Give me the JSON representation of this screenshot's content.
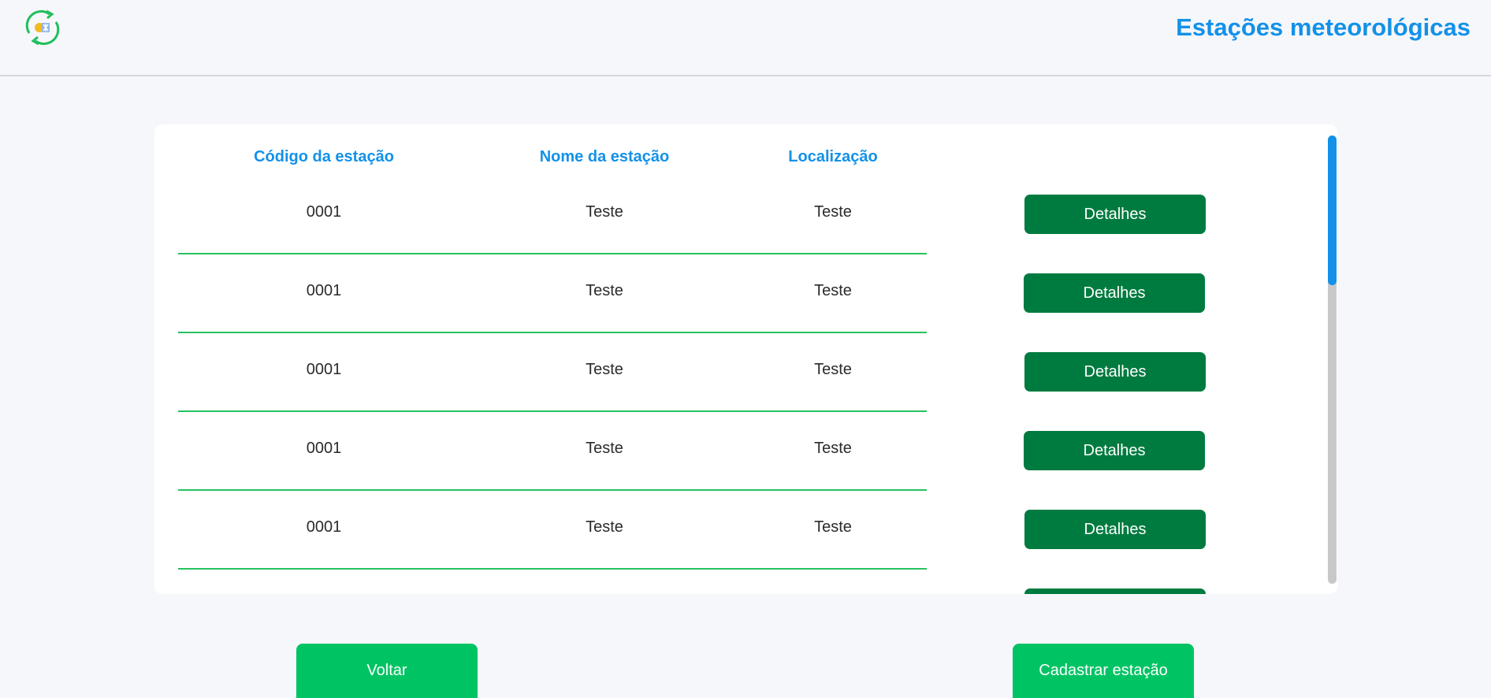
{
  "header": {
    "logo_icon": "weather-cycle-logo-icon",
    "title": "Estações meteorológicas"
  },
  "table": {
    "columns": [
      "Código da estação",
      "Nome da estação",
      "Localização"
    ],
    "rows": [
      {
        "code": "0001",
        "name": "Teste",
        "location": "Teste",
        "action": "Detalhes"
      },
      {
        "code": "0001",
        "name": "Teste",
        "location": "Teste",
        "action": "Detalhes"
      },
      {
        "code": "0001",
        "name": "Teste",
        "location": "Teste",
        "action": "Detalhes"
      },
      {
        "code": "0001",
        "name": "Teste",
        "location": "Teste",
        "action": "Detalhes"
      },
      {
        "code": "0001",
        "name": "Teste",
        "location": "Teste",
        "action": "Detalhes"
      }
    ],
    "partial_row_action": ""
  },
  "actions": {
    "back_label": "Voltar",
    "register_label": "Cadastrar estação"
  },
  "colors": {
    "accent_blue": "#1391e8",
    "details_green": "#007b40",
    "primary_green": "#00c464",
    "divider_green": "#27c261"
  }
}
